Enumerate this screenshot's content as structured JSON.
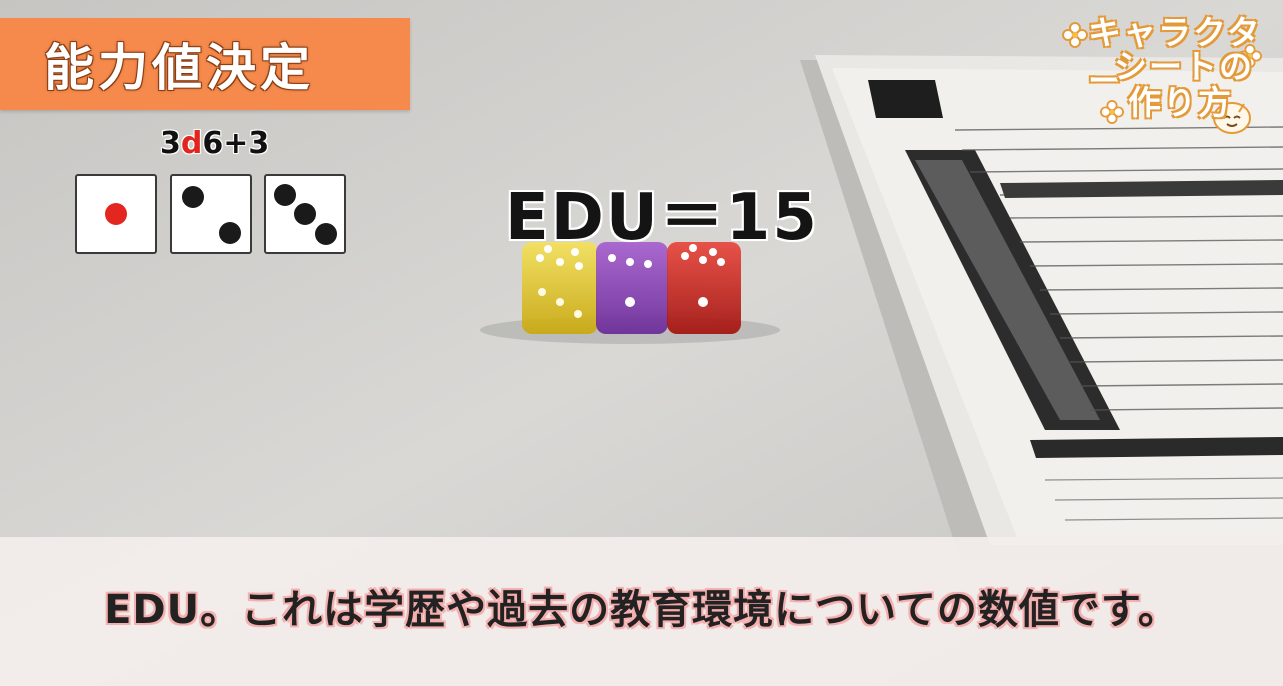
{
  "title": "能力値決定",
  "formula": {
    "prefix": "3",
    "accent": "d",
    "suffix": "6+3"
  },
  "dice_faces": [
    1,
    2,
    3
  ],
  "result": "EDU＝15",
  "subtitle": "EDU。これは学歴や過去の教育環境についての数値です。",
  "series_logo": {
    "line1": "キャラクター",
    "line2": "シートの",
    "line3": "作り方"
  },
  "colors": {
    "title_badge": "#f58a4c",
    "accent_red": "#e3261f",
    "logo_outline": "#e49a3a"
  }
}
